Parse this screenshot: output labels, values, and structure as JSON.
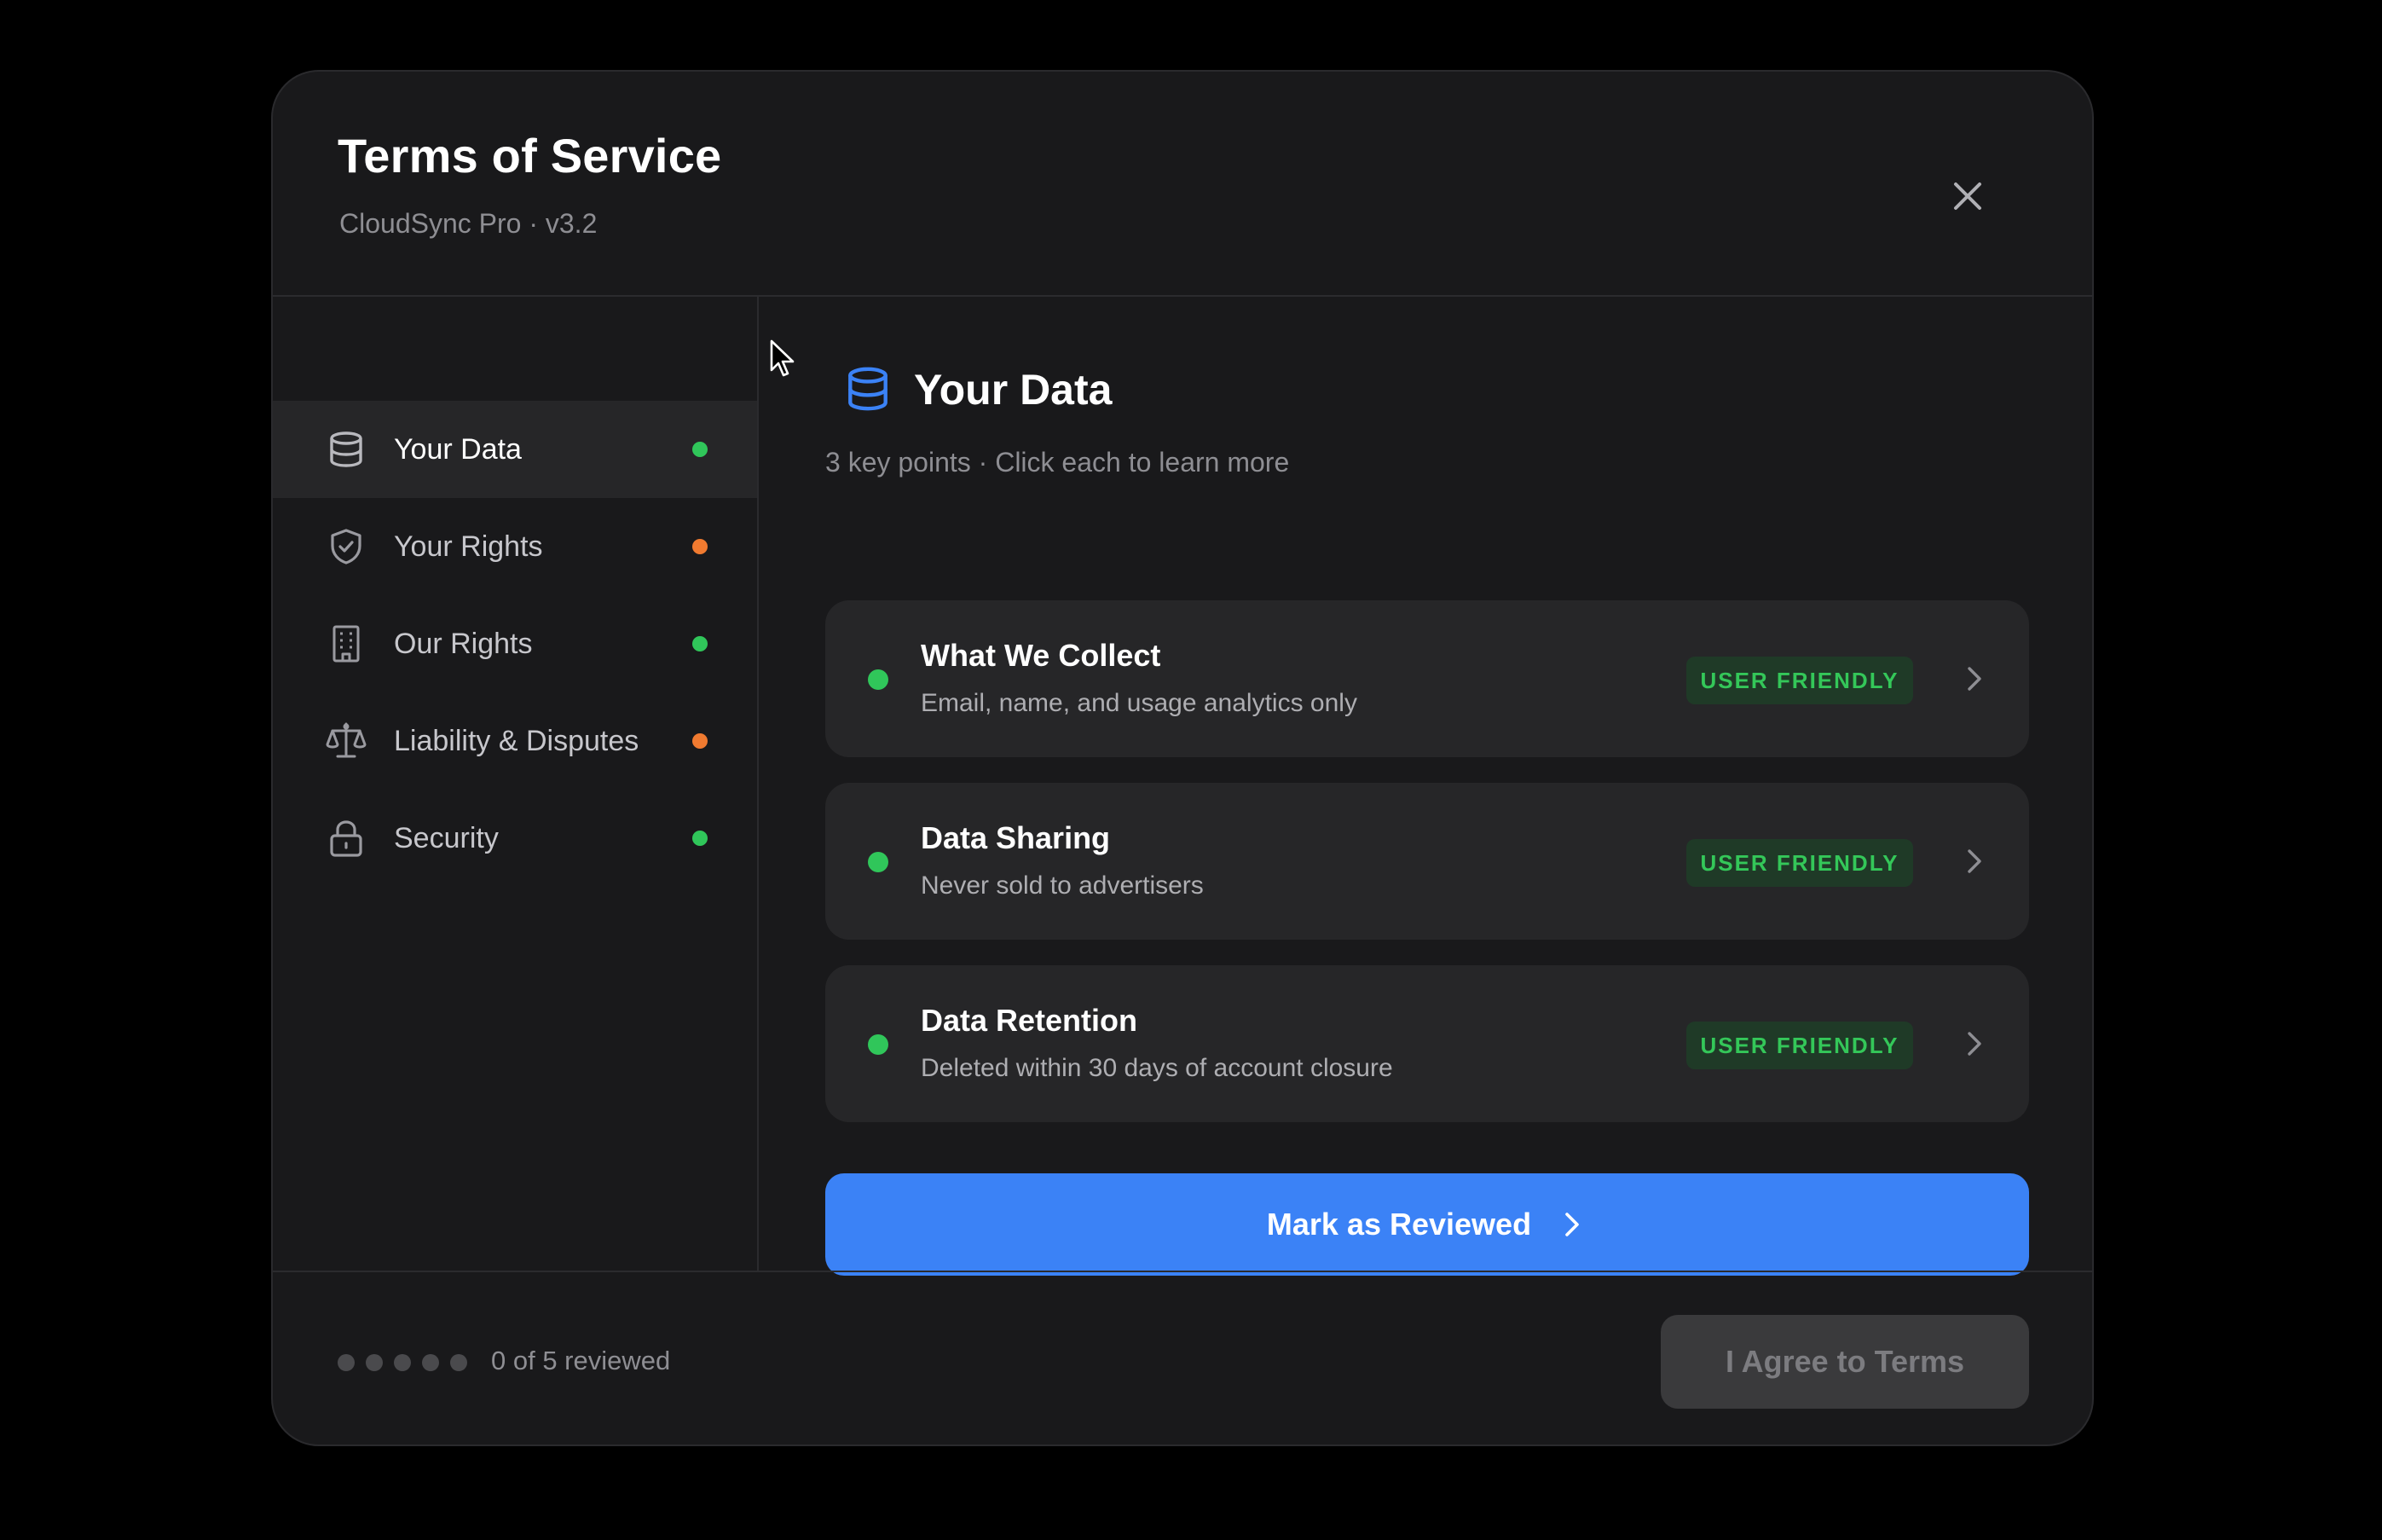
{
  "header": {
    "title": "Terms of Service",
    "subtitle": "CloudSync Pro · v3.2",
    "close_icon": "close-icon"
  },
  "sidebar": {
    "items": [
      {
        "label": "Your Data",
        "icon": "database-icon",
        "status": "green",
        "active": true
      },
      {
        "label": "Your Rights",
        "icon": "shield-check-icon",
        "status": "orange",
        "active": false
      },
      {
        "label": "Our Rights",
        "icon": "building-icon",
        "status": "green",
        "active": false
      },
      {
        "label": "Liability & Disputes",
        "icon": "scale-icon",
        "status": "orange",
        "active": false
      },
      {
        "label": "Security",
        "icon": "lock-icon",
        "status": "green",
        "active": false
      }
    ]
  },
  "main": {
    "section_icon": "database-icon",
    "section_title": "Your Data",
    "section_sub": "3 key points · Click each to learn more",
    "cards": [
      {
        "title": "What We Collect",
        "desc": "Email, name, and usage analytics only",
        "badge": "USER FRIENDLY"
      },
      {
        "title": "Data Sharing",
        "desc": "Never sold to advertisers",
        "badge": "USER FRIENDLY"
      },
      {
        "title": "Data Retention",
        "desc": "Deleted within 30 days of account closure",
        "badge": "USER FRIENDLY"
      }
    ],
    "primary_button": "Mark as Reviewed"
  },
  "footer": {
    "progress_text": "0 of 5 reviewed",
    "reviewed_count": 0,
    "total_count": 5,
    "agree_button": "I Agree to Terms"
  },
  "colors": {
    "green": "#30c65a",
    "orange": "#f07a30",
    "accent_blue": "#3b82f6",
    "badge_bg": "#1f3a27",
    "badge_text": "#34c759"
  }
}
